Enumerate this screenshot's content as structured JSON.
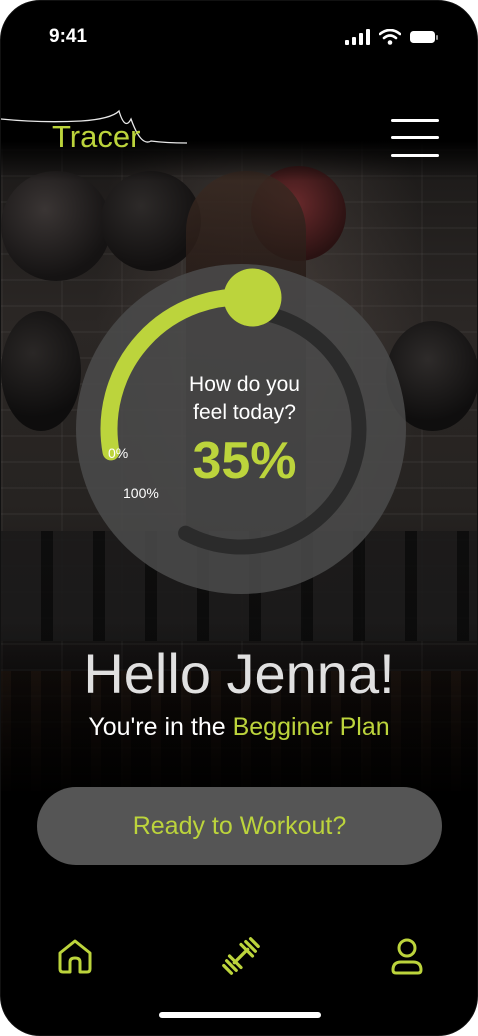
{
  "status_bar": {
    "time": "9:41"
  },
  "header": {
    "brand": "Tracer"
  },
  "mood": {
    "question": "How do you feel today?",
    "value_label": "35%",
    "value_fraction": 0.35,
    "min_label": "0%",
    "max_label": "100%"
  },
  "greeting": {
    "title": "Hello Jenna!",
    "plan_prefix": "You're in the ",
    "plan_name": "Begginer Plan"
  },
  "cta": {
    "label": "Ready to Workout?"
  },
  "bottom_nav": {
    "items": [
      "home-icon",
      "dumbbell-icon",
      "profile-icon"
    ]
  },
  "colors": {
    "accent": "#bcd43c",
    "button_bg": "#555555",
    "ring_bg": "#4a4a4a",
    "ring_track": "#2b2b2b"
  }
}
